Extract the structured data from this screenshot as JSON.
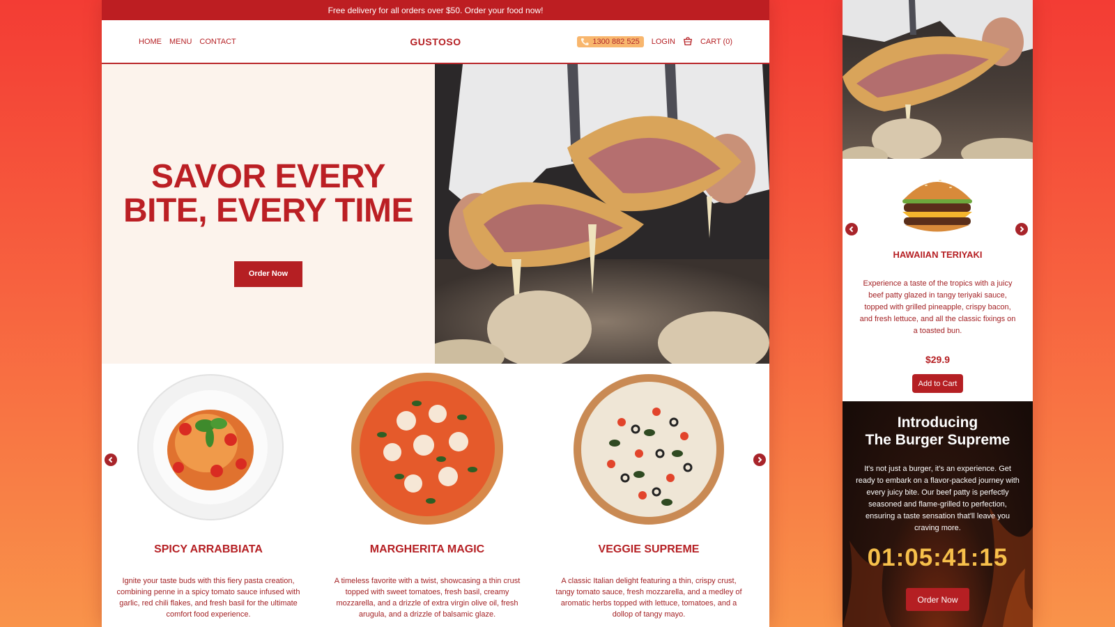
{
  "promo_bar": {
    "text": "Free delivery for all orders over $50. Order your food now!"
  },
  "nav": {
    "links": [
      "HOME",
      "MENU",
      "CONTACT"
    ],
    "brand": "GUSTOSO",
    "phone": "1300 882 525",
    "login": "LOGIN",
    "cart": "CART (0)"
  },
  "hero": {
    "title_line1": "SAVOR EVERY",
    "title_line2": "BITE, EVERY TIME",
    "cta": "Order Now"
  },
  "products": [
    {
      "name": "SPICY ARRABBIATA",
      "description": "Ignite your taste buds with this fiery pasta creation, combining penne in a spicy tomato sauce infused with garlic, red chili flakes, and fresh basil for the ultimate comfort food experience."
    },
    {
      "name": "MARGHERITA MAGIC",
      "description": "A timeless favorite with a twist, showcasing a thin crust topped with sweet tomatoes, fresh basil, creamy mozzarella, and a drizzle of extra virgin olive oil, fresh arugula, and a drizzle of balsamic glaze."
    },
    {
      "name": "VEGGIE SUPREME",
      "description": "A classic Italian delight featuring a thin, crispy crust, tangy tomato sauce, fresh mozzarella, and a medley of aromatic herbs topped with lettuce, tomatoes, and a dollop of tangy mayo."
    }
  ],
  "mobile": {
    "product": {
      "name": "HAWAIIAN TERIYAKI",
      "description": "Experience a taste of the tropics with a juicy beef patty glazed in tangy teriyaki sauce, topped with grilled pineapple, crispy bacon, and fresh lettuce, and all the classic fixings on a toasted bun.",
      "price": "$29.9",
      "add_to_cart": "Add to Cart"
    },
    "promo": {
      "title_line1": "Introducing",
      "title_line2": "The Burger Supreme",
      "text": "It's not just a burger, it's an experience. Get ready to embark on a flavor-packed journey with every juicy bite. Our beef patty is perfectly seasoned and flame-grilled to perfection, ensuring a taste sensation that'll leave you craving more.",
      "timer": "01:05:41:15",
      "cta": "Order Now"
    }
  },
  "icons": [
    "phone-icon",
    "cart-icon",
    "chevron-left-icon",
    "chevron-right-icon"
  ],
  "colors": {
    "brand_red": "#b51f23",
    "hero_bg": "#fcf3ec",
    "phone_pill": "#f8b66d",
    "timer": "#f7c04b"
  }
}
